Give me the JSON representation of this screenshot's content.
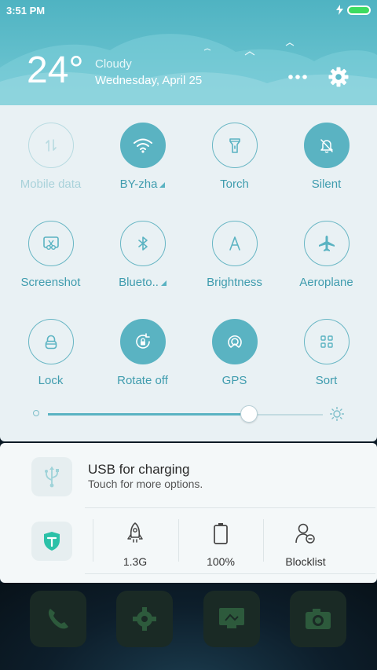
{
  "status_bar": {
    "time": "3:51 PM"
  },
  "header": {
    "temperature": "24°",
    "condition": "Cloudy",
    "date": "Wednesday, April 25"
  },
  "quick_settings": [
    {
      "label": "Mobile data",
      "icon": "mobile-data-icon",
      "state": "disabled"
    },
    {
      "label": "BY-zha",
      "icon": "wifi-icon",
      "state": "active",
      "has_dropdown": true
    },
    {
      "label": "Torch",
      "icon": "torch-icon",
      "state": "off"
    },
    {
      "label": "Silent",
      "icon": "bell-off-icon",
      "state": "active"
    },
    {
      "label": "Screenshot",
      "icon": "screenshot-icon",
      "state": "off"
    },
    {
      "label": "Blueto..",
      "icon": "bluetooth-icon",
      "state": "off",
      "has_dropdown": true
    },
    {
      "label": "Brightness",
      "icon": "brightness-a-icon",
      "state": "off"
    },
    {
      "label": "Aeroplane",
      "icon": "airplane-icon",
      "state": "off"
    },
    {
      "label": "Lock",
      "icon": "lock-icon",
      "state": "off"
    },
    {
      "label": "Rotate off",
      "icon": "rotate-lock-icon",
      "state": "active"
    },
    {
      "label": "GPS",
      "icon": "gps-icon",
      "state": "active"
    },
    {
      "label": "Sort",
      "icon": "grid-icon",
      "state": "off"
    }
  ],
  "brightness": {
    "level": 0.73
  },
  "notification": {
    "title": "USB for charging",
    "subtitle": "Touch for more options."
  },
  "quick_actions": [
    {
      "label": "1.3G",
      "icon": "rocket-icon"
    },
    {
      "label": "100%",
      "icon": "battery-icon"
    },
    {
      "label": "Blocklist",
      "icon": "blocklist-icon"
    }
  ],
  "colors": {
    "accent": "#5ab3c2",
    "header_bg": "#5fbccb",
    "panel_bg": "#e9f1f4"
  }
}
